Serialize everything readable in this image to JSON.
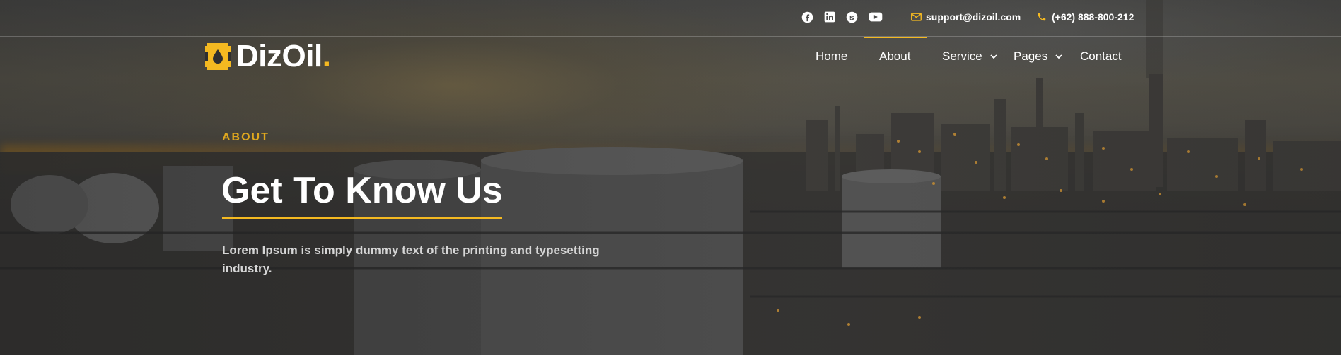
{
  "topbar": {
    "social": [
      {
        "name": "facebook-icon"
      },
      {
        "name": "linkedin-icon"
      },
      {
        "name": "skype-icon"
      },
      {
        "name": "youtube-icon"
      }
    ],
    "email": "support@dizoil.com",
    "phone": "(+62) 888-800-212"
  },
  "logo": {
    "text": "DizOil",
    "dot": "."
  },
  "nav": {
    "items": [
      {
        "label": "Home"
      },
      {
        "label": "About"
      },
      {
        "label": "Service"
      },
      {
        "label": "Pages"
      },
      {
        "label": "Contact"
      }
    ],
    "active": "About"
  },
  "hero": {
    "eyebrow": "ABOUT",
    "title": "Get To Know Us",
    "description": "Lorem Ipsum is simply dummy text of the printing and typesetting industry."
  },
  "colors": {
    "accent": "#f4b921"
  }
}
